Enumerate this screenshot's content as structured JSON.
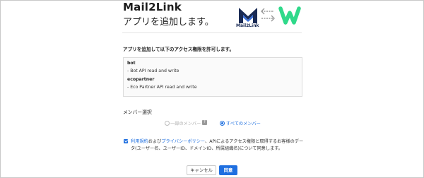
{
  "header": {
    "app_name": "Mail2Link",
    "subtitle": "アプリを追加します。",
    "logo_text": "Mail2Link"
  },
  "permissions": {
    "heading": "アプリを追加して以下のアクセス権限を許可します。",
    "items": [
      {
        "name": "bot",
        "description": "- Bot API read and write"
      },
      {
        "name": "ecopartner",
        "description": "- Eco Partner API read and write"
      }
    ]
  },
  "member_selection": {
    "heading": "メンバー選択",
    "options": [
      {
        "label": "一部のメンバー",
        "selected": false,
        "disabled": true
      },
      {
        "label": "すべてのメンバー",
        "selected": true,
        "disabled": false
      }
    ],
    "help_icon": "?"
  },
  "consent": {
    "checked": true,
    "terms_link": "利用規約",
    "and_text": "および",
    "privacy_link": "プライバシーポリシー",
    "rest_text": "、APIによるアクセス権限と取得するお客様のデータ(ユーザー名、ユーザーID、ドメインID、所属組織名)について同意します。"
  },
  "buttons": {
    "cancel": "キャンセル",
    "agree": "同意"
  },
  "colors": {
    "accent": "#1e6fe0",
    "w_logo_green": "#2fd98a",
    "m2l_navy": "#1a2b55"
  }
}
